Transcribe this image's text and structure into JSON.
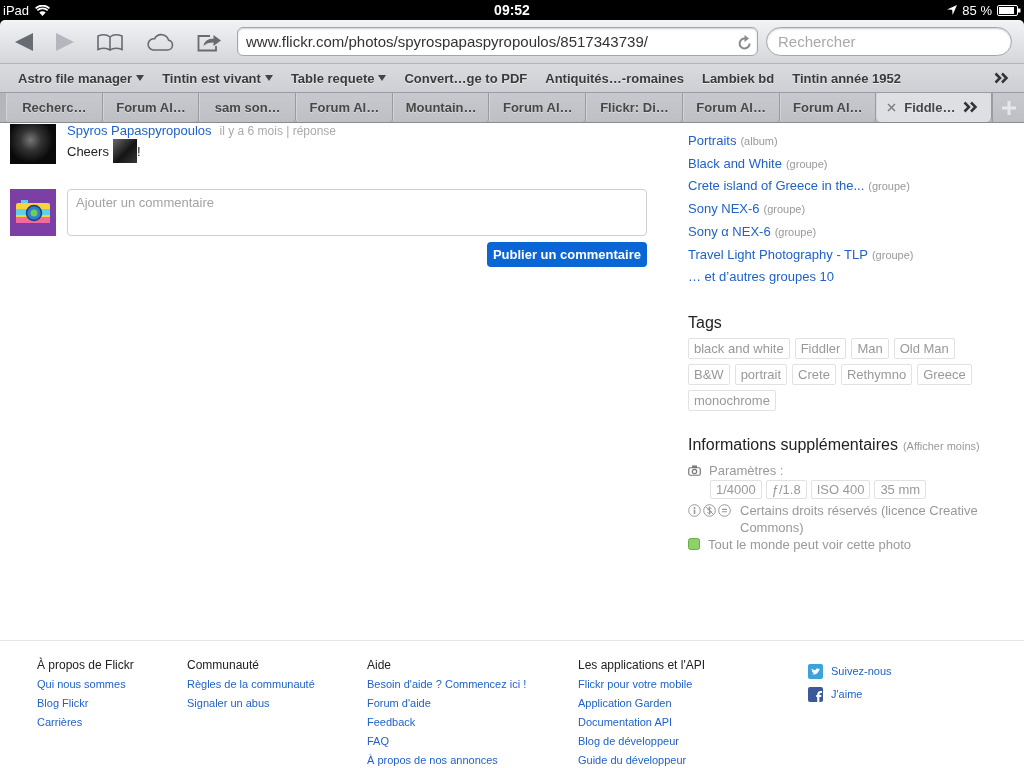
{
  "status_bar": {
    "device": "iPad",
    "time": "09:52",
    "battery": "85 %"
  },
  "toolbar": {
    "buttons": [
      {
        "kind": "back",
        "disabled": false
      },
      {
        "kind": "forward",
        "disabled": true
      },
      {
        "kind": "bookmarks",
        "disabled": false
      },
      {
        "kind": "icloud",
        "disabled": false
      },
      {
        "kind": "share",
        "disabled": false
      }
    ],
    "url": "www.flickr.com/photos/spyrospapaspyropoulos/8517343739/",
    "search": {
      "placeholder": "Rechercher"
    }
  },
  "bookmarks_bar": {
    "items": [
      {
        "label": "Astro file manager",
        "folder": true
      },
      {
        "label": "Tintin est vivant",
        "folder": true
      },
      {
        "label": "Table requete",
        "folder": true
      },
      {
        "label": "Convert…ge to PDF",
        "folder": false
      },
      {
        "label": "Antiquités…-romaines",
        "folder": false
      },
      {
        "label": "Lambiek bd",
        "folder": false
      },
      {
        "label": "Tintin année 1952",
        "folder": false
      }
    ]
  },
  "tabs": [
    {
      "label": "Recherc…",
      "selected": false
    },
    {
      "label": "Forum Al…",
      "selected": false
    },
    {
      "label": "sam son…",
      "selected": false
    },
    {
      "label": "Forum Al…",
      "selected": false
    },
    {
      "label": "Mountain…",
      "selected": false
    },
    {
      "label": "Forum Al…",
      "selected": false
    },
    {
      "label": "Flickr: Di…",
      "selected": false
    },
    {
      "label": "Forum Al…",
      "selected": false
    },
    {
      "label": "Forum Al…",
      "selected": false
    },
    {
      "label": "Fiddle…",
      "selected": true
    }
  ],
  "comments": [
    {
      "author": "Spyros Papaspyropoulos",
      "meta": "il y a 6 mois | réponse",
      "message": [
        {
          "kind": "text",
          "text": "Cheers"
        },
        {
          "kind": "image"
        },
        {
          "kind": "text",
          "text": "!"
        }
      ]
    }
  ],
  "comment_form": {
    "placeholder": "Ajouter un commentaire",
    "button": "Publier un commentaire"
  },
  "sidebar": {
    "collections": [
      {
        "name": "Portraits",
        "type": "(album)"
      },
      {
        "name": "Black and White",
        "type": "(groupe)"
      },
      {
        "name": "Crete island of Greece in the...",
        "type": "(groupe)"
      },
      {
        "name": "Sony NEX-6",
        "type": "(groupe)"
      },
      {
        "name": "Sony α NEX-6",
        "type": "(groupe)"
      },
      {
        "name": "Travel Light Photography - TLP",
        "type": "(groupe)"
      },
      {
        "name": "… et d’autres groupes 10"
      }
    ],
    "tags": {
      "title": "Tags",
      "items": [
        "black and white",
        "Fiddler",
        "Man",
        "Old Man",
        "B&W",
        "portrait",
        "Crete",
        "Rethymno",
        "Greece",
        "monochrome"
      ]
    },
    "info": {
      "title": "Informations supplémentaires",
      "toggle": "(Afficher moins)",
      "settings_label": "Paramètres :",
      "settings": [
        "1/4000",
        "ƒ/1.8",
        "ISO 400",
        "35 mm"
      ],
      "license": "Certains droits réservés (licence Creative Commons)",
      "visibility": "Tout le monde peut voir cette photo"
    }
  },
  "footer": {
    "columns": [
      {
        "title": "À propos de Flickr",
        "links": [
          "Qui nous sommes",
          "Blog Flickr",
          "Carrières"
        ]
      },
      {
        "title": "Communauté",
        "links": [
          "Règles de la communauté",
          "Signaler un abus"
        ]
      },
      {
        "title": "Aide",
        "links": [
          "Besoin d'aide ? Commencez ici !",
          "Forum d'aide",
          "Feedback",
          "FAQ",
          "À propos de nos annonces"
        ]
      },
      {
        "title": "Les applications et l'API",
        "links": [
          "Flickr pour votre mobile",
          "Application Garden",
          "Documentation API",
          "Blog de développeur",
          "Guide du développeur"
        ]
      }
    ],
    "social": [
      {
        "kind": "twitter",
        "label": "Suivez-nous"
      },
      {
        "kind": "facebook",
        "label": "J'aime"
      }
    ]
  }
}
